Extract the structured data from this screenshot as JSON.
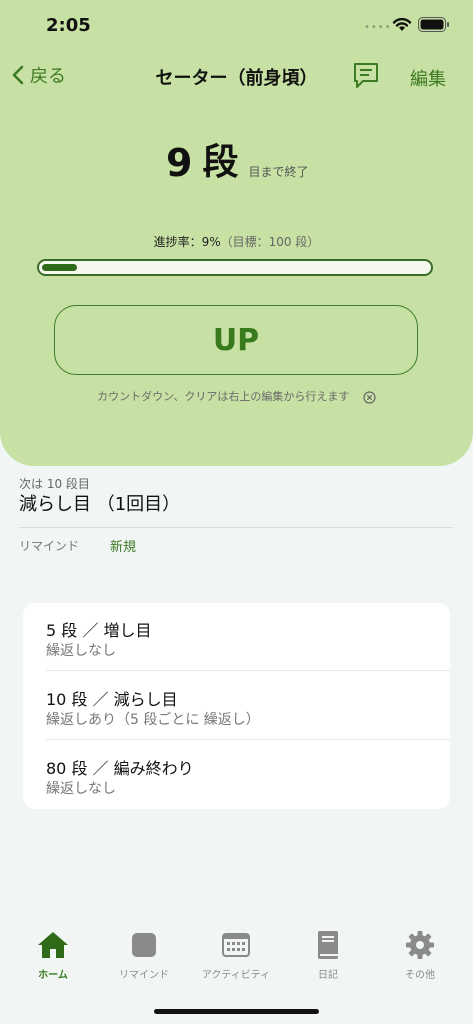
{
  "status": {
    "time": "2:05"
  },
  "nav": {
    "back_label": "戻る",
    "title": "セーター（前身頃）",
    "edit_label": "編集"
  },
  "counter": {
    "current": "9",
    "unit": "段",
    "suffix": "目まで終了"
  },
  "progress": {
    "label": "進捗率：9%",
    "goal": "（目標：100 段）",
    "percent": 9
  },
  "up_button_label": "UP",
  "hint": "カウントダウン、クリアは右上の編集から行えます",
  "next": {
    "label": "次は 10 段目",
    "title": "減らし目 （1回目）"
  },
  "remind": {
    "label": "リマインド",
    "new_label": "新規"
  },
  "reminders": [
    {
      "title": "5 段 ／ 増し目",
      "sub": "繰返しなし"
    },
    {
      "title": "10 段 ／ 減らし目",
      "sub": "繰返しあり（5 段ごとに 繰返し）"
    },
    {
      "title": "80 段 ／ 編み終わり",
      "sub": "繰返しなし"
    }
  ],
  "tabs": [
    {
      "label": "ホーム",
      "icon": "home-icon"
    },
    {
      "label": "リマインド",
      "icon": "square-icon"
    },
    {
      "label": "アクティビティ",
      "icon": "calendar-icon"
    },
    {
      "label": "日記",
      "icon": "book-icon"
    },
    {
      "label": "その他",
      "icon": "gear-icon"
    }
  ],
  "colors": {
    "accent": "#3a7a1f",
    "panel": "#c6e1a3",
    "background": "#f1f6f5"
  }
}
